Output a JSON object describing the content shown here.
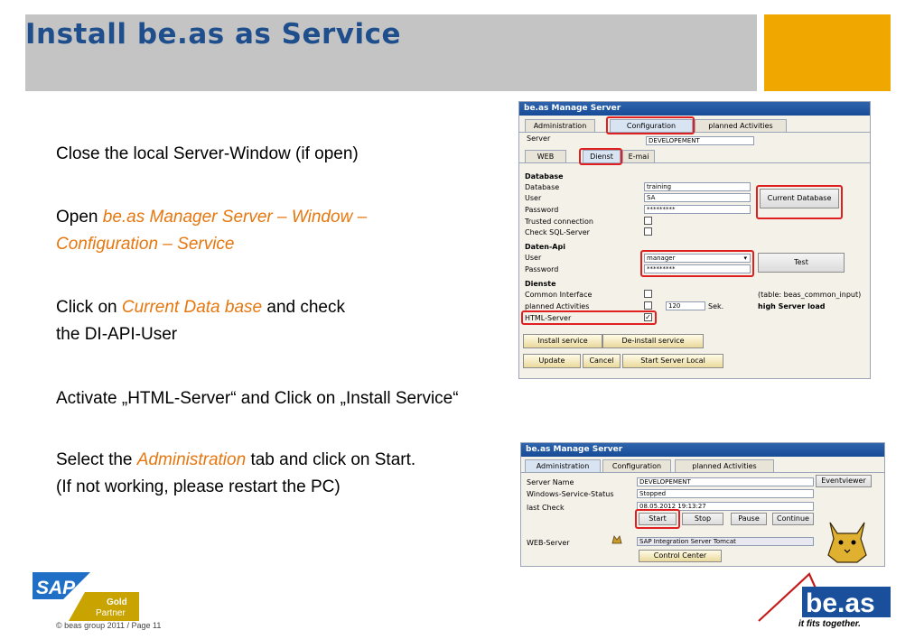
{
  "title": "Install be.as as Service",
  "instructions": {
    "p1": "Close the local Server-Window (if open)",
    "p2_prefix": "Open ",
    "p2_highlight_1": "be.as Manager Server – Window –",
    "p2_highlight_2": "Configuration – Service",
    "p3_prefix": "Click on ",
    "p3_highlight": "Current Data base",
    "p3_suffix": " and check",
    "p3_line2": "the DI-API-User",
    "p4": "Activate „HTML-Server“ and Click on „Install Service“",
    "p5_prefix": "Select the ",
    "p5_highlight": "Administration",
    "p5_suffix": " tab and click on Start.",
    "p5_line2": "(If not working, please restart the PC)"
  },
  "config_window": {
    "title": "be.as Manage Server",
    "tabs": [
      "Administration",
      "Configuration",
      "planned Activities"
    ],
    "server_label": "Server",
    "server_value": "DEVELOPEMENT",
    "subtabs": [
      "WEB",
      "Dienst",
      "E-mai"
    ],
    "database_section": "Database",
    "database_label": "Database",
    "database_value": "training",
    "user_label": "User",
    "user_value": "SA",
    "password_label": "Password",
    "password_value": "*********",
    "trusted_label": "Trusted connection",
    "check_sql_label": "Check SQL-Server",
    "current_db_button": "Current Database",
    "dapi_section": "Daten-Api",
    "dapi_user_label": "User",
    "dapi_user_value": "manager",
    "dapi_password_label": "Password",
    "dapi_password_value": "*********",
    "test_button": "Test",
    "services_section": "Dienste",
    "common_interface_label": "Common Interface",
    "common_interface_note": "(table: beas_common_input)",
    "planned_activities_label": "planned Activities",
    "planned_interval": "120",
    "sek_label": "Sek.",
    "high_load_note": "high Server load",
    "html_server_label": "HTML-Server",
    "html_server_checked": "✓",
    "install_button": "Install service",
    "deinstall_button": "De-install service",
    "update_button": "Update",
    "cancel_button": "Cancel",
    "start_local_button": "Start Server Local"
  },
  "admin_window": {
    "title": "be.as Manage Server",
    "tabs": [
      "Administration",
      "Configuration",
      "planned Activities"
    ],
    "server_name_label": "Server Name",
    "server_name_value": "DEVELOPEMENT",
    "status_label": "Windows-Service-Status",
    "status_value": "Stopped",
    "last_check_label": "last Check",
    "last_check_value": "08.05.2012 19:13:27",
    "eventviewer_button": "Eventviewer",
    "start_button": "Start",
    "stop_button": "Stop",
    "pause_button": "Pause",
    "continue_button": "Continue",
    "web_server_label": "WEB-Server",
    "web_server_value": "SAP Integration Server Tomcat",
    "control_center_button": "Control Center"
  },
  "sap_logo": {
    "brand": "SAP",
    "line1": "Gold",
    "line2": "Partner"
  },
  "beas_logo": {
    "brand": "be.as",
    "tagline": "it fits together."
  },
  "footer": "© beas group 2011 / Page 11",
  "colors": {
    "title": "#1f4e8c",
    "accent": "#f0a800",
    "highlight": "#e6770f",
    "title_bar": "#c4c4c4"
  }
}
